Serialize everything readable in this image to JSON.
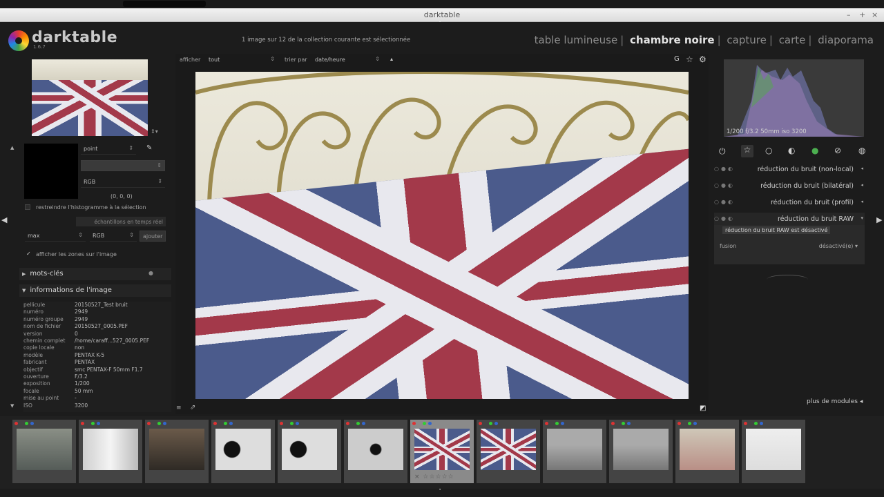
{
  "window": {
    "title": "darktable"
  },
  "app": {
    "name": "darktable",
    "version": "1.6.7"
  },
  "header": {
    "selection_info": "1 image sur 12 de la collection courante est sélectionnée",
    "views": [
      "table lumineuse",
      "chambre noire",
      "capture",
      "carte",
      "diaporama"
    ],
    "active_view": "chambre noire"
  },
  "toolbar": {
    "show_label": "afficher",
    "show_value": "tout",
    "sort_label": "trier par",
    "sort_value": "date/heure"
  },
  "colorpicker": {
    "mode": "point",
    "model": "RGB",
    "values": "(0, 0, 0)",
    "restrict_label": "restreindre l'histogramme à la sélection",
    "live_samples_label": "échantillons en temps réel",
    "stat": "max",
    "stat_model": "RGB",
    "add_button": "ajouter",
    "show_areas_label": "afficher les zones sur l'image"
  },
  "sections": {
    "keywords": "mots-clés",
    "image_info": "informations de l'image"
  },
  "image_info": [
    {
      "k": "pellicule",
      "v": "20150527_Test bruit"
    },
    {
      "k": "numéro",
      "v": "2949"
    },
    {
      "k": "numéro groupe",
      "v": "2949"
    },
    {
      "k": "nom de fichier",
      "v": "20150527_0005.PEF"
    },
    {
      "k": "version",
      "v": "0"
    },
    {
      "k": "chemin complet",
      "v": "/home/caraff...527_0005.PEF"
    },
    {
      "k": "copie locale",
      "v": "non"
    },
    {
      "k": "modèle",
      "v": "PENTAX K-5"
    },
    {
      "k": "fabricant",
      "v": "PENTAX"
    },
    {
      "k": "objectif",
      "v": "smc PENTAX-F 50mm F1.7"
    },
    {
      "k": "ouverture",
      "v": "F/3.2"
    },
    {
      "k": "exposition",
      "v": "1/200"
    },
    {
      "k": "focale",
      "v": "50 mm"
    },
    {
      "k": "mise au point",
      "v": "-"
    },
    {
      "k": "ISO",
      "v": "3200"
    }
  ],
  "histogram": {
    "caption": "1/200 f/3.2 50mm iso 3200"
  },
  "modules": [
    {
      "name": "réduction du bruit (non-local)",
      "arrow": "◂"
    },
    {
      "name": "réduction du bruit (bilatéral)",
      "arrow": "◂"
    },
    {
      "name": "réduction du bruit (profil)",
      "arrow": "◂"
    },
    {
      "name": "réduction du bruit RAW",
      "arrow": "▾"
    }
  ],
  "module_open": {
    "tooltip": "réduction du bruit RAW est désactivé",
    "fusion_label": "fusion",
    "fusion_value": "désactivé(e)"
  },
  "more_modules": "plus de modules",
  "filmstrip": {
    "count": 12,
    "selected_index": 6,
    "selected_rating": 0
  }
}
